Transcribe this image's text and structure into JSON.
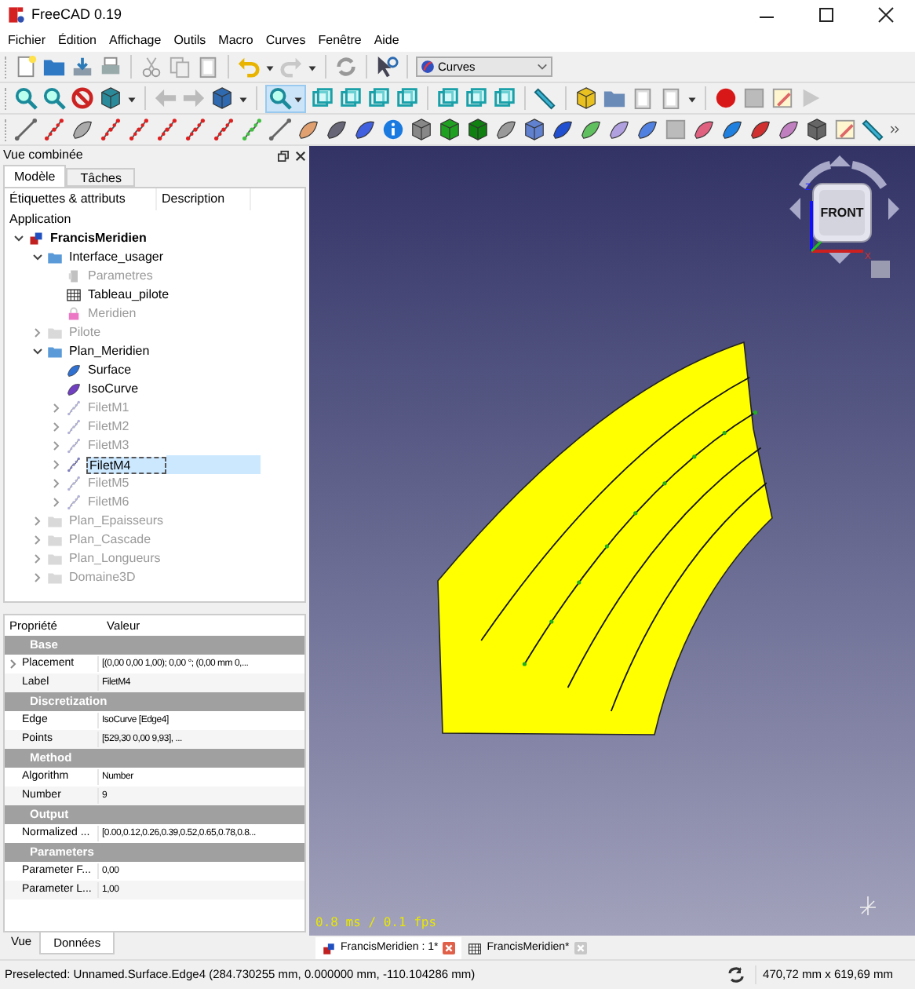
{
  "window": {
    "title": "FreeCAD 0.19"
  },
  "menu": [
    "Fichier",
    "Édition",
    "Affichage",
    "Outils",
    "Macro",
    "Curves",
    "Fenêtre",
    "Aide"
  ],
  "toolbars": {
    "workbench": "Curves",
    "zoom_button_pressed": true
  },
  "combo_view": {
    "title": "Vue combinée",
    "tabs": [
      {
        "label": "Modèle",
        "selected": true
      },
      {
        "label": "Tâches",
        "selected": false
      }
    ],
    "tree": {
      "columns": [
        "Étiquettes & attributs",
        "Description"
      ],
      "root": "Application",
      "items": [
        {
          "label": "FrancisMeridien",
          "kind": "document",
          "expanded": true,
          "visible": true,
          "selected": false,
          "children": [
            {
              "label": "Interface_usager",
              "kind": "folder",
              "expanded": true,
              "visible": true,
              "selected": false,
              "children": [
                {
                  "label": "Parametres",
                  "kind": "parameters",
                  "visible": false,
                  "selected": false
                },
                {
                  "label": "Tableau_pilote",
                  "kind": "spreadsheet",
                  "visible": true,
                  "selected": false
                },
                {
                  "label": "Meridien",
                  "kind": "lock",
                  "visible": false,
                  "selected": false
                }
              ]
            },
            {
              "label": "Pilote",
              "kind": "folder",
              "expanded": false,
              "visible": false,
              "selected": false
            },
            {
              "label": "Plan_Meridien",
              "kind": "folder",
              "expanded": true,
              "visible": true,
              "selected": false,
              "children": [
                {
                  "label": "Surface",
                  "kind": "surface",
                  "visible": true,
                  "selected": false
                },
                {
                  "label": "IsoCurve",
                  "kind": "isocurve",
                  "visible": true,
                  "selected": false
                },
                {
                  "label": "FiletM1",
                  "kind": "filet",
                  "expanded": false,
                  "visible": false,
                  "selected": false
                },
                {
                  "label": "FiletM2",
                  "kind": "filet",
                  "expanded": false,
                  "visible": false,
                  "selected": false
                },
                {
                  "label": "FiletM3",
                  "kind": "filet",
                  "expanded": false,
                  "visible": false,
                  "selected": false
                },
                {
                  "label": "FiletM4",
                  "kind": "filet",
                  "expanded": false,
                  "visible": true,
                  "selected": true
                },
                {
                  "label": "FiletM5",
                  "kind": "filet",
                  "expanded": false,
                  "visible": false,
                  "selected": false
                },
                {
                  "label": "FiletM6",
                  "kind": "filet",
                  "expanded": false,
                  "visible": false,
                  "selected": false
                }
              ]
            },
            {
              "label": "Plan_Epaisseurs",
              "kind": "folder",
              "expanded": false,
              "visible": false,
              "selected": false
            },
            {
              "label": "Plan_Cascade",
              "kind": "folder",
              "expanded": false,
              "visible": false,
              "selected": false
            },
            {
              "label": "Plan_Longueurs",
              "kind": "folder",
              "expanded": false,
              "visible": false,
              "selected": false
            },
            {
              "label": "Domaine3D",
              "kind": "folder",
              "expanded": false,
              "visible": false,
              "selected": false
            }
          ]
        }
      ]
    },
    "properties": {
      "columns": [
        "Propriété",
        "Valeur"
      ],
      "groups": [
        {
          "name": "Base",
          "rows": [
            {
              "name": "Placement",
              "value": "[(0,00 0,00 1,00); 0,00 °; (0,00 mm  0,...",
              "expandable": true
            },
            {
              "name": "Label",
              "value": "FiletM4",
              "expandable": false
            }
          ]
        },
        {
          "name": "Discretization",
          "rows": [
            {
              "name": "Edge",
              "value": "IsoCurve [Edge4]",
              "expandable": false
            },
            {
              "name": "Points",
              "value": "[529,30 0,00 9,93], ...",
              "expandable": false
            }
          ]
        },
        {
          "name": "Method",
          "rows": [
            {
              "name": "Algorithm",
              "value": "Number",
              "expandable": false
            },
            {
              "name": "Number",
              "value": "9",
              "expandable": false
            }
          ]
        },
        {
          "name": "Output",
          "rows": [
            {
              "name": "Normalized ...",
              "value": "[0.00,0.12,0.26,0.39,0.52,0.65,0.78,0.8...",
              "expandable": false
            }
          ]
        },
        {
          "name": "Parameters",
          "rows": [
            {
              "name": "Parameter F...",
              "value": "0,00",
              "expandable": false
            },
            {
              "name": "Parameter L...",
              "value": "1,00",
              "expandable": false
            }
          ]
        }
      ]
    },
    "bottom_tabs": [
      {
        "label": "Vue",
        "selected": false
      },
      {
        "label": "Données",
        "selected": true
      }
    ]
  },
  "viewport": {
    "fps": "0.8 ms / 0.1 fps",
    "nav_cube": {
      "face": "FRONT",
      "z_label": "Z",
      "x_label": "X"
    }
  },
  "document_tabs": [
    {
      "label": "FrancisMeridien : 1*",
      "kind": "model",
      "selected": true
    },
    {
      "label": "FrancisMeridien*",
      "kind": "spreadsheet",
      "selected": false
    }
  ],
  "status_bar": {
    "message": "Preselected: Unnamed.Surface.Edge4 (284.730255 mm, 0.000000 mm, -110.104286 mm)",
    "dimensions": "470,72 mm x 619,69 mm"
  }
}
